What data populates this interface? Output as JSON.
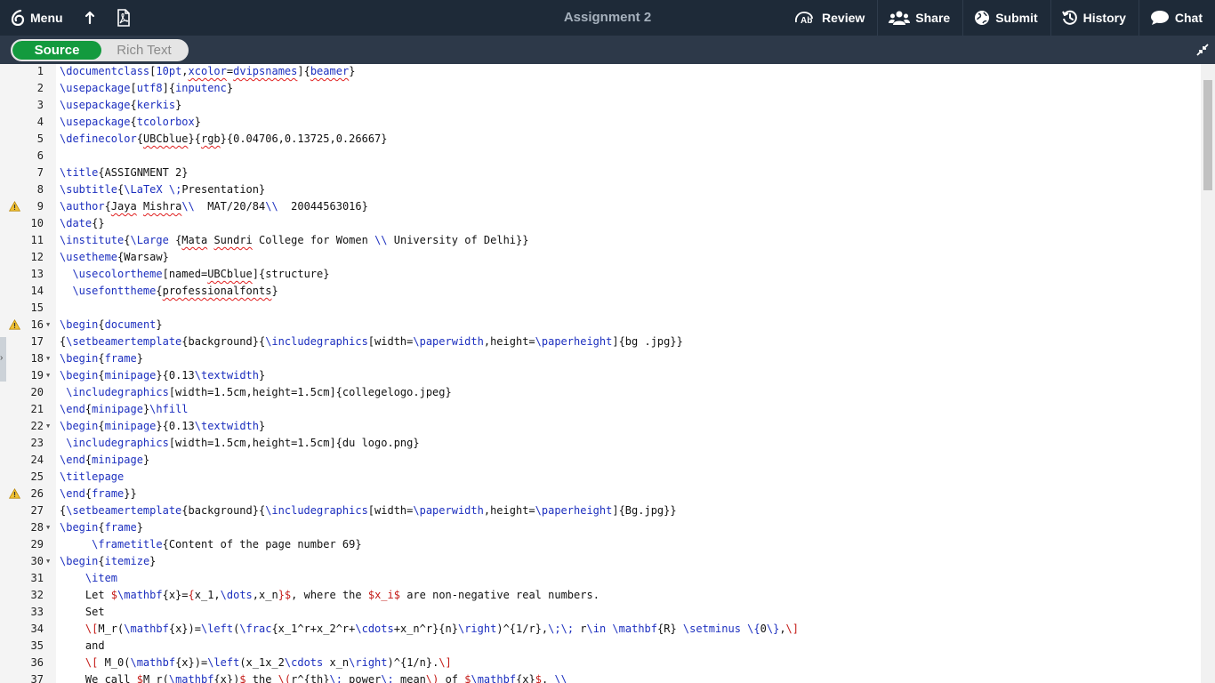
{
  "toolbar": {
    "menu_label": "Menu",
    "title": "Assignment 2",
    "review_label": "Review",
    "share_label": "Share",
    "submit_label": "Submit",
    "history_label": "History",
    "chat_label": "Chat"
  },
  "mode_toggle": {
    "source_label": "Source",
    "rich_label": "Rich Text",
    "active": "Source"
  },
  "editor": {
    "lines": [
      {
        "n": "1",
        "html": "<span class=\"cmd\">\\documentclass</span>[<span class=\"kw\">10pt</span>,<span class=\"kw sq\">xcolor</span>=<span class=\"kw sq\">dvipsnames</span>]{<span class=\"kw sq\">beamer</span>}"
      },
      {
        "n": "2",
        "html": "<span class=\"cmd\">\\usepackage</span>[<span class=\"kw\">utf8</span>]{<span class=\"kw\">inputenc</span>}"
      },
      {
        "n": "3",
        "html": "<span class=\"cmd\">\\usepackage</span>{<span class=\"kw\">kerkis</span>}"
      },
      {
        "n": "4",
        "html": "<span class=\"cmd\">\\usepackage</span>{<span class=\"kw\">tcolorbox</span>}"
      },
      {
        "n": "5",
        "html": "<span class=\"cmd\">\\definecolor</span>{<span class=\"sq\">UBCblue</span>}{<span class=\"sq\">rgb</span>}{0.04706,0.13725,0.26667}"
      },
      {
        "n": "6",
        "html": ""
      },
      {
        "n": "7",
        "html": "<span class=\"cmd\">\\title</span>{ASSIGNMENT 2}"
      },
      {
        "n": "8",
        "html": "<span class=\"cmd\">\\subtitle</span>{<span class=\"cmd\">\\LaTeX</span> <span class=\"cmd\">\\;</span>Presentation}"
      },
      {
        "n": "9",
        "warn": true,
        "html": "<span class=\"cmd\">\\author</span>{<span class=\"sq\">Jaya</span> <span class=\"sq\">Mishra</span><span class=\"cmd\">\\\\</span>  MAT/20/84<span class=\"cmd\">\\\\</span>  20044563016}"
      },
      {
        "n": "10",
        "html": "<span class=\"cmd\">\\date</span>{}"
      },
      {
        "n": "11",
        "html": "<span class=\"cmd\">\\institute</span>{<span class=\"cmd\">\\Large</span> {<span class=\"sq\">Mata</span> <span class=\"sq\">Sundri</span> College for Women <span class=\"cmd\">\\\\</span> University of Delhi}}"
      },
      {
        "n": "12",
        "html": "<span class=\"cmd\">\\usetheme</span>{Warsaw}"
      },
      {
        "n": "13",
        "html": "  <span class=\"cmd\">\\usecolortheme</span>[named=<span class=\"sq\">UBCblue</span>]{structure}"
      },
      {
        "n": "14",
        "html": "  <span class=\"cmd\">\\usefonttheme</span>{<span class=\"sq\">professionalfonts</span>}"
      },
      {
        "n": "15",
        "html": ""
      },
      {
        "n": "16",
        "warn": true,
        "fold": true,
        "html": "<span class=\"cmd\">\\begin</span>{<span class=\"kw\">document</span>}"
      },
      {
        "n": "17",
        "html": "{<span class=\"cmd\">\\setbeamertemplate</span>{background}{<span class=\"cmd\">\\includegraphics</span>[width=<span class=\"cmd\">\\paperwidth</span>,height=<span class=\"cmd\">\\paperheight</span>]{bg .jpg}}"
      },
      {
        "n": "18",
        "fold": true,
        "html": "<span class=\"cmd\">\\begin</span>{<span class=\"kw\">frame</span>}"
      },
      {
        "n": "19",
        "fold": true,
        "html": "<span class=\"cmd\">\\begin</span>{<span class=\"kw\">minipage</span>}{0.13<span class=\"cmd\">\\textwidth</span>}"
      },
      {
        "n": "20",
        "html": " <span class=\"cmd\">\\includegraphics</span>[width=1.5cm,height=1.5cm]{collegelogo.jpeg}"
      },
      {
        "n": "21",
        "html": "<span class=\"cmd\">\\end</span>{<span class=\"kw\">minipage</span>}<span class=\"cmd\">\\hfill</span>"
      },
      {
        "n": "22",
        "fold": true,
        "html": "<span class=\"cmd\">\\begin</span>{<span class=\"kw\">minipage</span>}{0.13<span class=\"cmd\">\\textwidth</span>}"
      },
      {
        "n": "23",
        "html": " <span class=\"cmd\">\\includegraphics</span>[width=1.5cm,height=1.5cm]{du logo.png}"
      },
      {
        "n": "24",
        "html": "<span class=\"cmd\">\\end</span>{<span class=\"kw\">minipage</span>}"
      },
      {
        "n": "25",
        "html": "<span class=\"cmd\">\\titlepage</span>"
      },
      {
        "n": "26",
        "warn": true,
        "html": "<span class=\"cmd\">\\end</span>{<span class=\"kw\">frame</span>}}"
      },
      {
        "n": "27",
        "html": "{<span class=\"cmd\">\\setbeamertemplate</span>{background}{<span class=\"cmd\">\\includegraphics</span>[width=<span class=\"cmd\">\\paperwidth</span>,height=<span class=\"cmd\">\\paperheight</span>]{Bg.jpg}}"
      },
      {
        "n": "28",
        "fold": true,
        "html": "<span class=\"cmd\">\\begin</span>{<span class=\"kw\">frame</span>}"
      },
      {
        "n": "29",
        "html": "     <span class=\"cmd\">\\frametitle</span>{Content of the page number 69}"
      },
      {
        "n": "30",
        "fold": true,
        "html": "<span class=\"cmd\">\\begin</span>{<span class=\"kw\">itemize</span>}"
      },
      {
        "n": "31",
        "html": "    <span class=\"cmd\">\\item</span>"
      },
      {
        "n": "32",
        "html": "    Let <span class=\"red\">$</span><span class=\"cmd\">\\mathbf</span>{x}=<span class=\"red\">{</span>x_1,<span class=\"cmd\">\\dots</span>,x_n<span class=\"red\">}$</span>, where the <span class=\"red\">$x_i$</span> are non-negative real numbers."
      },
      {
        "n": "33",
        "html": "    Set"
      },
      {
        "n": "34",
        "html": "    <span class=\"red\">\\[</span>M_r(<span class=\"cmd\">\\mathbf</span>{x})=<span class=\"cmd\">\\left</span>(<span class=\"cmd\">\\frac</span>{x_1^r+x_2^r+<span class=\"cmd\">\\cdots</span>+x_n^r}{n}<span class=\"cmd\">\\right</span>)^{1/r},<span class=\"cmd\">\\;\\;</span> r<span class=\"cmd\">\\in</span> <span class=\"cmd\">\\mathbf</span>{R} <span class=\"cmd\">\\setminus</span> <span class=\"cmd\">\\{</span>0<span class=\"cmd\">\\}</span>,<span class=\"red\">\\]</span>"
      },
      {
        "n": "35",
        "html": "    and"
      },
      {
        "n": "36",
        "html": "    <span class=\"red\">\\[</span> M_0(<span class=\"cmd\">\\mathbf</span>{x})=<span class=\"cmd\">\\left</span>(x_1x_2<span class=\"cmd\">\\cdots</span> x_n<span class=\"cmd\">\\right</span>)^{1/n}.<span class=\"red\">\\]</span>"
      },
      {
        "n": "37",
        "html": "    We call <span class=\"red\">$</span>M_r(<span class=\"cmd\">\\mathbf</span>{x})<span class=\"red\">$</span> the <span class=\"red\">\\(</span>r^{th}<span class=\"cmd\">\\;</span> power<span class=\"cmd\">\\;</span> mean<span class=\"red\">\\)</span> of <span class=\"red\">$</span><span class=\"cmd\">\\mathbf</span>{x}<span class=\"red\">$</span>. <span class=\"cmd\">\\\\</span>"
      }
    ]
  }
}
